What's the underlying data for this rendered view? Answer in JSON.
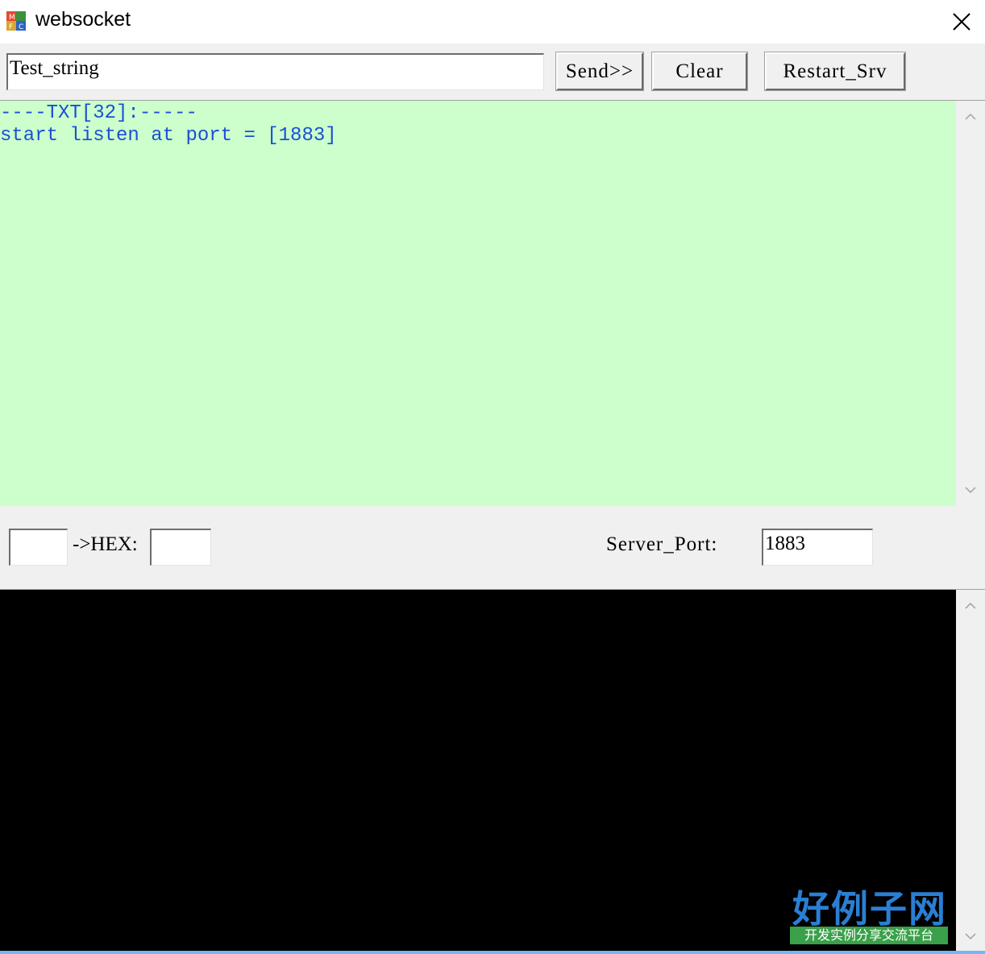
{
  "window": {
    "title": "websocket"
  },
  "icons": {
    "app": "mfc-app-icon",
    "close": "close-icon",
    "scroll_up": "chevron-up-icon",
    "scroll_down": "chevron-down-icon"
  },
  "toolbar": {
    "message_value": "Test_string",
    "send_label": "Send>>",
    "clear_label": "Clear",
    "restart_label": "Restart_Srv"
  },
  "log": {
    "background": "#ccffcc",
    "text_color": "#1a4fd6",
    "lines": [
      "----TXT[32]:-----",
      "start listen at port = [1883]"
    ]
  },
  "hex": {
    "input_value": "",
    "label": "->HEX:",
    "output_value": ""
  },
  "server": {
    "port_label": "Server_Port:",
    "port_value": "1883"
  },
  "terminal": {
    "background": "#000000"
  },
  "watermark": {
    "title": "好例子网",
    "subtitle": "开发实例分享交流平台"
  }
}
